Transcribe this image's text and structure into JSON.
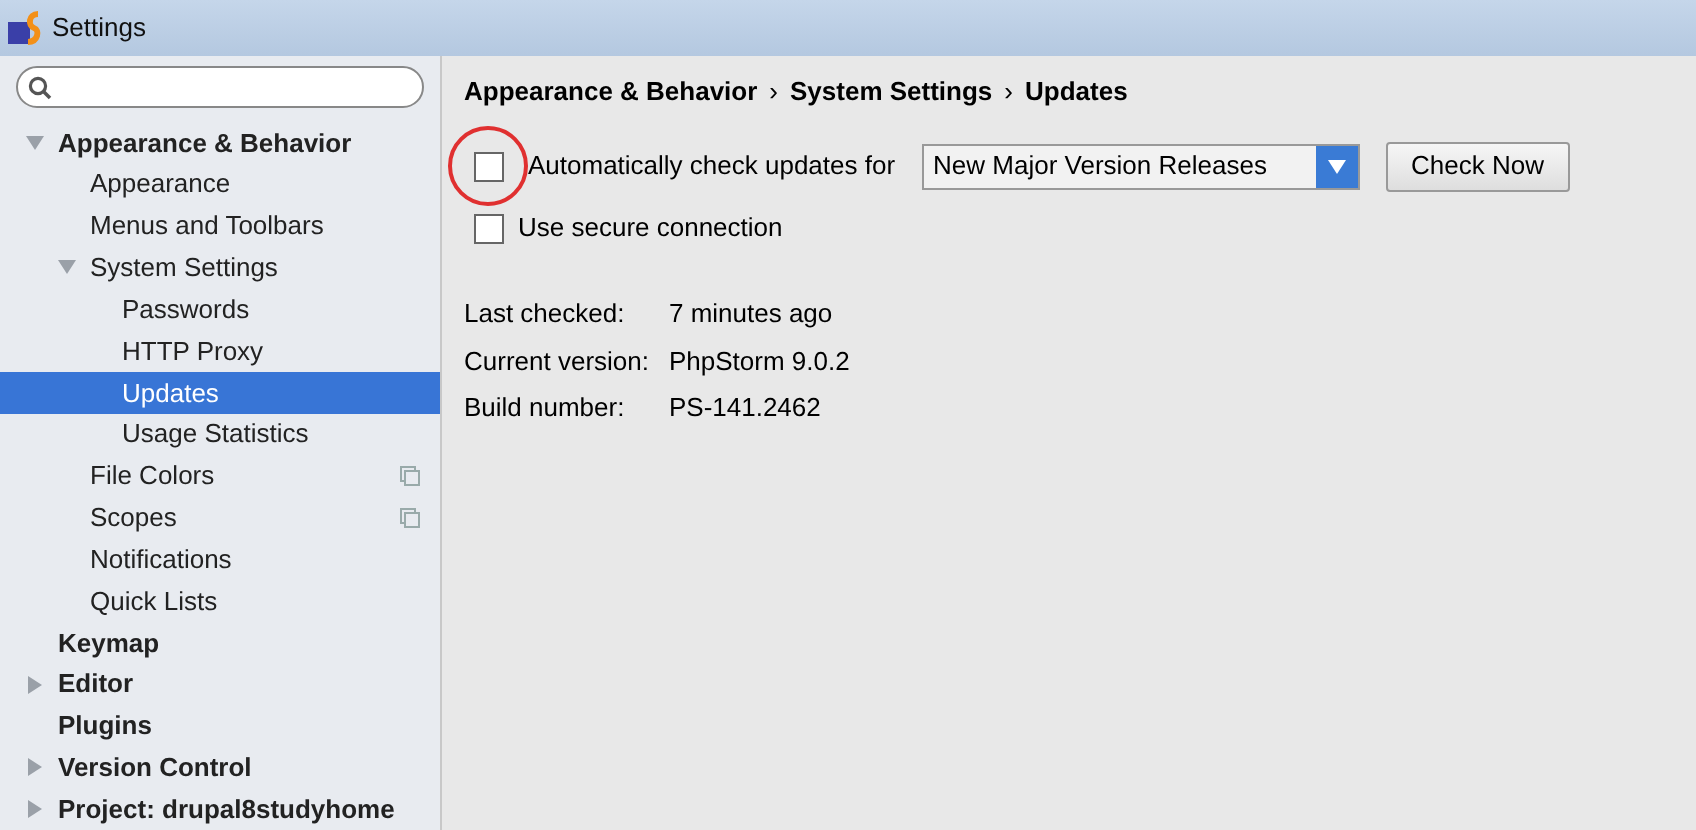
{
  "window": {
    "title": "Settings"
  },
  "sidebar": {
    "items": [
      {
        "label": "Appearance & Behavior",
        "expanded": true,
        "selected": false,
        "children": [
          {
            "label": "Appearance",
            "selected": false
          },
          {
            "label": "Menus and Toolbars",
            "selected": false
          },
          {
            "label": "System Settings",
            "expanded": true,
            "selected": false,
            "children": [
              {
                "label": "Passwords",
                "selected": false
              },
              {
                "label": "HTTP Proxy",
                "selected": false
              },
              {
                "label": "Updates",
                "selected": true
              },
              {
                "label": "Usage Statistics",
                "selected": false
              }
            ]
          },
          {
            "label": "File Colors",
            "selected": false,
            "copy_icon": true
          },
          {
            "label": "Scopes",
            "selected": false,
            "copy_icon": true
          },
          {
            "label": "Notifications",
            "selected": false
          },
          {
            "label": "Quick Lists",
            "selected": false
          }
        ]
      },
      {
        "label": "Keymap",
        "selected": false
      },
      {
        "label": "Editor",
        "expanded": false,
        "selected": false
      },
      {
        "label": "Plugins",
        "selected": false
      },
      {
        "label": "Version Control",
        "expanded": false,
        "selected": false
      },
      {
        "label": "Project: drupal8studyhome",
        "expanded": false,
        "selected": false
      }
    ]
  },
  "breadcrumb": [
    "Appearance & Behavior",
    "System Settings",
    "Updates"
  ],
  "breadcrumb_separator": "›",
  "auto_check": {
    "label": "Automatically check updates for",
    "checked": false,
    "circled": true,
    "dropdown": "New Major Version Releases",
    "button": "Check Now"
  },
  "secure": {
    "label": "Use secure connection",
    "checked": false
  },
  "info": [
    {
      "label": "Last checked:",
      "value": "7 minutes ago"
    },
    {
      "label": "Current version:",
      "value": "PhpStorm 9.0.2"
    },
    {
      "label": "Build number:",
      "value": "PS-141.2462"
    }
  ]
}
